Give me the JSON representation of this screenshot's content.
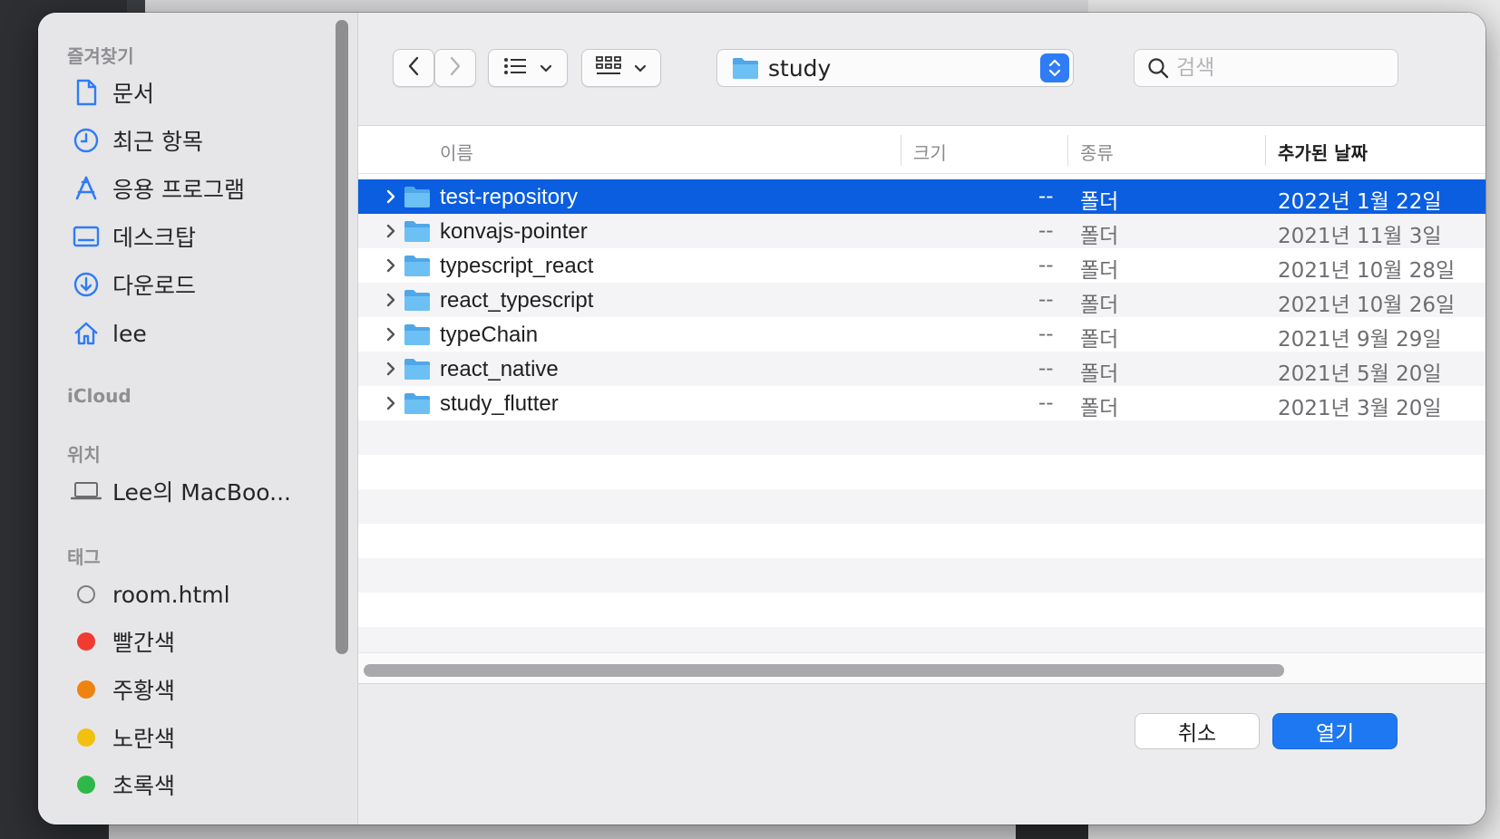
{
  "sidebar": {
    "favorites_title": "즐겨찾기",
    "favorites": [
      {
        "label": "문서",
        "icon": "document-icon"
      },
      {
        "label": "최근 항목",
        "icon": "clock-icon"
      },
      {
        "label": "응용 프로그램",
        "icon": "applications-icon"
      },
      {
        "label": "데스크탑",
        "icon": "desktop-icon"
      },
      {
        "label": "다운로드",
        "icon": "download-icon"
      },
      {
        "label": "lee",
        "icon": "home-icon"
      }
    ],
    "icloud_title": "iCloud",
    "locations_title": "위치",
    "locations": [
      {
        "label": "Lee의 MacBoo...",
        "icon": "laptop-icon"
      }
    ],
    "tags_title": "태그",
    "tags": [
      {
        "label": "room.html",
        "color": "none"
      },
      {
        "label": "빨간색",
        "color": "#f23b30"
      },
      {
        "label": "주황색",
        "color": "#f0820f"
      },
      {
        "label": "노란색",
        "color": "#f2c00e"
      },
      {
        "label": "초록색",
        "color": "#2fb84a"
      }
    ]
  },
  "toolbar": {
    "current_folder": "study",
    "search_placeholder": "검색"
  },
  "columns": {
    "name": "이름",
    "size": "크기",
    "kind": "종류",
    "date_added": "추가된 날짜"
  },
  "files": [
    {
      "name": "test-repository",
      "size": "--",
      "kind": "폴더",
      "date": "2022년 1월 22일",
      "selected": true
    },
    {
      "name": "konvajs-pointer",
      "size": "--",
      "kind": "폴더",
      "date": "2021년 11월 3일"
    },
    {
      "name": "typescript_react",
      "size": "--",
      "kind": "폴더",
      "date": "2021년 10월 28일"
    },
    {
      "name": "react_typescript",
      "size": "--",
      "kind": "폴더",
      "date": "2021년 10월 26일"
    },
    {
      "name": "typeChain",
      "size": "--",
      "kind": "폴더",
      "date": "2021년 9월 29일"
    },
    {
      "name": "react_native",
      "size": "--",
      "kind": "폴더",
      "date": "2021년 5월 20일"
    },
    {
      "name": "study_flutter",
      "size": "--",
      "kind": "폴더",
      "date": "2021년 3월 20일"
    }
  ],
  "footer": {
    "cancel_label": "취소",
    "open_label": "열기"
  },
  "colors": {
    "selection": "#0b5ee0",
    "accent": "#1e78f2",
    "folder": "#5fb4ee"
  }
}
